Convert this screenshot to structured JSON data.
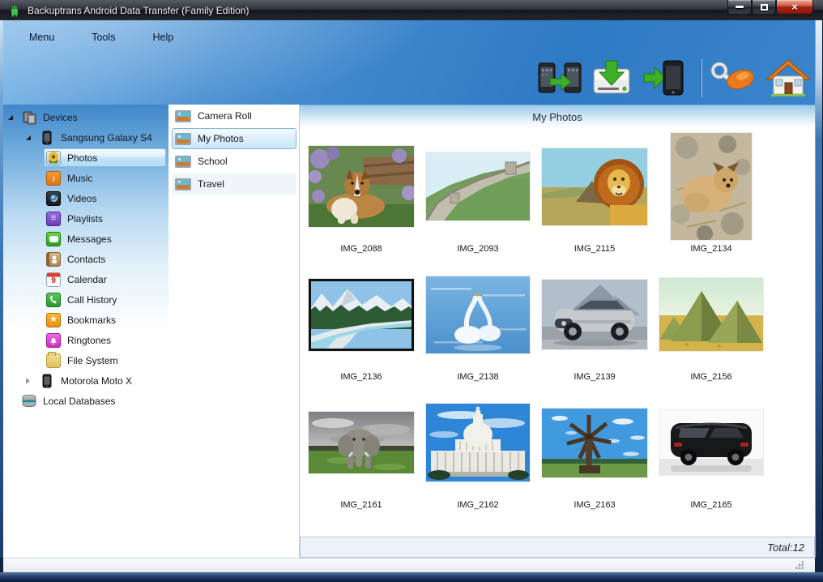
{
  "window": {
    "title": "Backuptrans Android Data Transfer (Family Edition)"
  },
  "menubar": {
    "items": [
      {
        "label": "Menu"
      },
      {
        "label": "Tools"
      },
      {
        "label": "Help"
      }
    ]
  },
  "toolbar": {
    "buttons": [
      {
        "name": "transfer-between-devices-icon"
      },
      {
        "name": "backup-to-computer-icon"
      },
      {
        "name": "restore-to-device-icon"
      },
      {
        "name": "register-key-icon"
      },
      {
        "name": "home-icon"
      }
    ]
  },
  "sidebar": {
    "items": [
      {
        "label": "Devices",
        "level": 0,
        "icon": "devices-icon",
        "state": "expanded"
      },
      {
        "label": "Sangsung Galaxy S4",
        "level": 1,
        "icon": "phone-icon",
        "state": "expanded"
      },
      {
        "label": "Photos",
        "level": 2,
        "icon": "photos-icon",
        "state": "selected"
      },
      {
        "label": "Music",
        "level": 2,
        "icon": "music-icon"
      },
      {
        "label": "Videos",
        "level": 2,
        "icon": "videos-icon"
      },
      {
        "label": "Playlists",
        "level": 2,
        "icon": "playlists-icon"
      },
      {
        "label": "Messages",
        "level": 2,
        "icon": "messages-icon"
      },
      {
        "label": "Contacts",
        "level": 2,
        "icon": "contacts-icon"
      },
      {
        "label": "Calendar",
        "level": 2,
        "icon": "calendar-icon",
        "badge": "9"
      },
      {
        "label": "Call History",
        "level": 2,
        "icon": "call-history-icon"
      },
      {
        "label": "Bookmarks",
        "level": 2,
        "icon": "bookmarks-icon"
      },
      {
        "label": "Ringtones",
        "level": 2,
        "icon": "ringtones-icon"
      },
      {
        "label": "File System",
        "level": 2,
        "icon": "file-system-icon"
      },
      {
        "label": "Motorola Moto X",
        "level": 1,
        "icon": "phone-icon",
        "state": "collapsed"
      },
      {
        "label": "Local Databases",
        "level": 0,
        "icon": "database-icon"
      }
    ]
  },
  "albums": {
    "items": [
      {
        "label": "Camera Roll"
      },
      {
        "label": "My Photos",
        "selected": true
      },
      {
        "label": "School"
      },
      {
        "label": "Travel"
      }
    ]
  },
  "main": {
    "title": "My Photos",
    "total": "Total:12"
  },
  "photos": [
    {
      "label": "IMG_2088",
      "subject": "collie dog among purple flowers"
    },
    {
      "label": "IMG_2093",
      "subject": "Great Wall of China"
    },
    {
      "label": "IMG_2115",
      "subject": "cartoon lion"
    },
    {
      "label": "IMG_2134",
      "subject": "puppy lying on rocky ground"
    },
    {
      "label": "IMG_2136",
      "subject": "mountain river landscape"
    },
    {
      "label": "IMG_2138",
      "subject": "two swans on blue water"
    },
    {
      "label": "IMG_2139",
      "subject": "silver sports car"
    },
    {
      "label": "IMG_2156",
      "subject": "pyramids in desert"
    },
    {
      "label": "IMG_2161",
      "subject": "elephant on grassland"
    },
    {
      "label": "IMG_2162",
      "subject": "US Capitol building"
    },
    {
      "label": "IMG_2163",
      "subject": "old wooden windmill"
    },
    {
      "label": "IMG_2165",
      "subject": "black car rear view"
    }
  ],
  "colors": {
    "selection_border": "#7fc0e8",
    "selection_fill": "#c2e4f8",
    "window_glass": "#2f7ac4",
    "close_button": "#a82415",
    "header_band": "#9ccbe8"
  }
}
